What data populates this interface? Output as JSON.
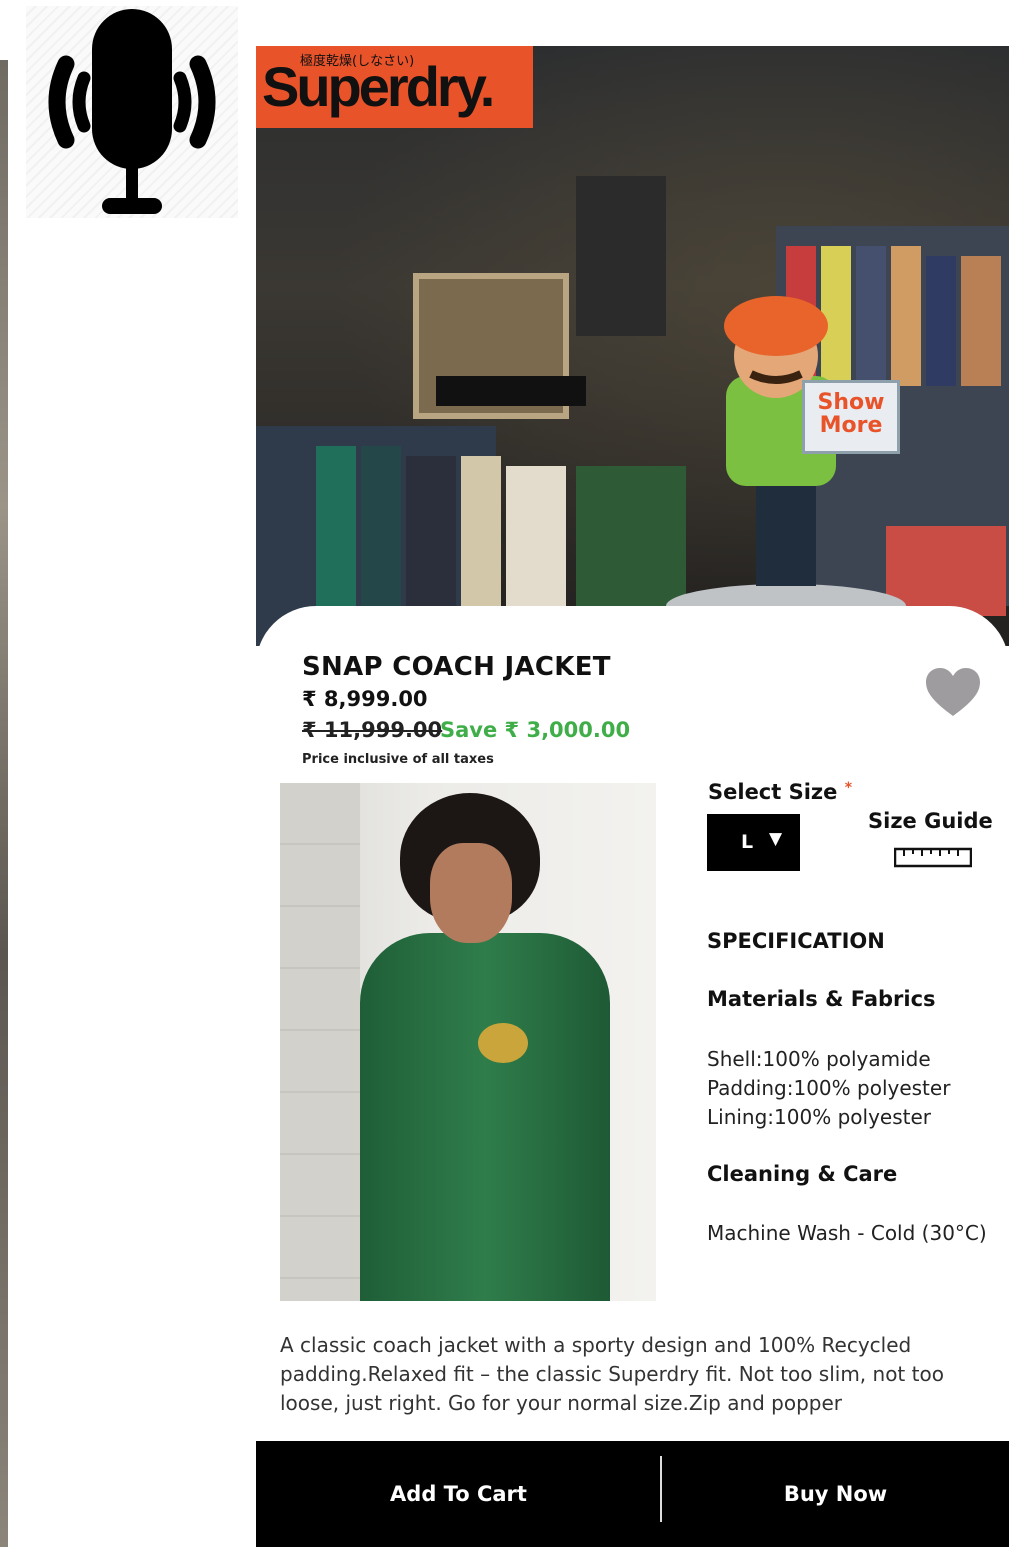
{
  "brand": {
    "name": "Superdry.",
    "tagline_jp": "極度乾燥(しなさい)"
  },
  "hero": {
    "show_more": "Show More"
  },
  "product": {
    "title": "SNAP COACH JACKET",
    "price": "₹ 8,999.00",
    "mrp": "₹ 11,999.00",
    "save": "Save ₹ 3,000.00",
    "tax_note": "Price inclusive of all taxes"
  },
  "size": {
    "label": "Select Size",
    "required_mark": "*",
    "selected": "L",
    "guide_label": "Size Guide"
  },
  "spec": {
    "heading": "SPECIFICATION",
    "materials_heading": "Materials & Fabrics",
    "materials_lines": [
      "Shell:100% polyamide",
      "Padding:100% polyester",
      "Lining:100% polyester"
    ],
    "care_heading": "Cleaning & Care",
    "care_text": "Machine Wash - Cold (30°C)"
  },
  "description": "A classic coach jacket with a sporty design and 100% Recycled padding.Relaxed fit – the classic Superdry fit. Not too slim, not too loose, just right. Go for your normal size.Zip and popper",
  "actions": {
    "add_to_cart": "Add To Cart",
    "buy_now": "Buy Now"
  },
  "icons": {
    "mic": "microphone-broadcast-icon",
    "heart": "heart-icon",
    "ruler": "ruler-icon",
    "caret": "caret-down-icon"
  },
  "colors": {
    "accent": "#e8532a",
    "save_green": "#3fae49",
    "heart_gray": "#9e9c9e",
    "bar": "#000000"
  }
}
